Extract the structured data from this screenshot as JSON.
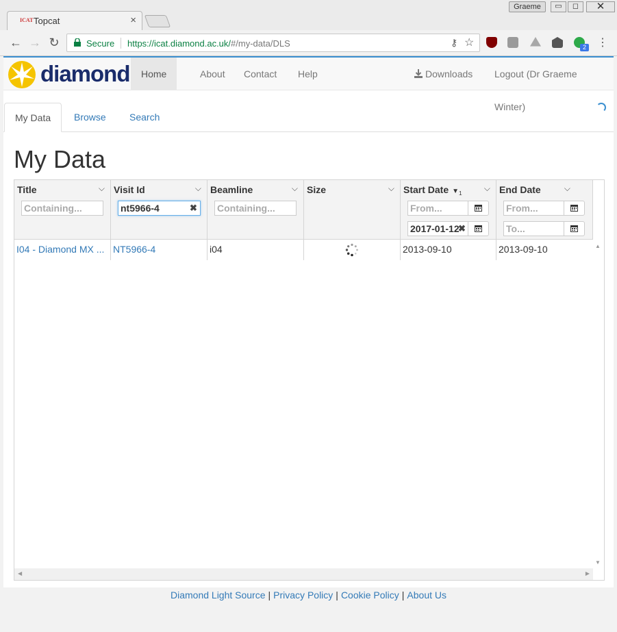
{
  "browser": {
    "profile_name": "Graeme",
    "tab_title": "Topcat",
    "tab_favicon_text": "ICAT",
    "secure_label": "Secure",
    "url_host": "https://icat.diamond.ac.uk/",
    "url_path": "#/my-data/DLS",
    "extension_badge": "2",
    "icons": [
      "back-icon",
      "forward-icon",
      "reload-icon",
      "lock-icon",
      "key-icon",
      "star-icon",
      "menu-icon"
    ]
  },
  "navbar": {
    "logo_text": "diamond",
    "items": [
      {
        "label": "Home",
        "active": true
      },
      {
        "label": "About"
      },
      {
        "label": "Contact"
      },
      {
        "label": "Help"
      }
    ],
    "downloads_label": "Downloads",
    "logout_label": "Logout (Dr Graeme Winter)"
  },
  "tabs": [
    {
      "label": "My Data",
      "active": true
    },
    {
      "label": "Browse"
    },
    {
      "label": "Search"
    }
  ],
  "page_title": "My Data",
  "grid": {
    "columns": [
      {
        "label": "Title",
        "filter_placeholder": "Containing..."
      },
      {
        "label": "Visit Id",
        "filter_value": "nt5966-4"
      },
      {
        "label": "Beamline",
        "filter_placeholder": "Containing..."
      },
      {
        "label": "Size"
      },
      {
        "label": "Start Date",
        "sort_indicator": "1",
        "sort_dir": "desc",
        "from_placeholder": "From...",
        "to_value": "2017-01-12"
      },
      {
        "label": "End Date",
        "from_placeholder": "From...",
        "to_placeholder": "To..."
      }
    ],
    "rows": [
      {
        "title": "I04 - Diamond MX ...",
        "visit_id": "NT5966-4",
        "beamline": "i04",
        "size": "loading",
        "start_date": "2013-09-10",
        "end_date": "2013-09-10"
      }
    ]
  },
  "footer": {
    "links": [
      "Diamond Light Source",
      "Privacy Policy",
      "Cookie Policy",
      "About Us"
    ],
    "separator": "|"
  },
  "colors": {
    "link": "#337ab7",
    "secure_green": "#0b8043",
    "logo_navy": "#1a2c6b",
    "logo_yellow": "#f5c400",
    "accent_blue": "#3a8fd0"
  }
}
